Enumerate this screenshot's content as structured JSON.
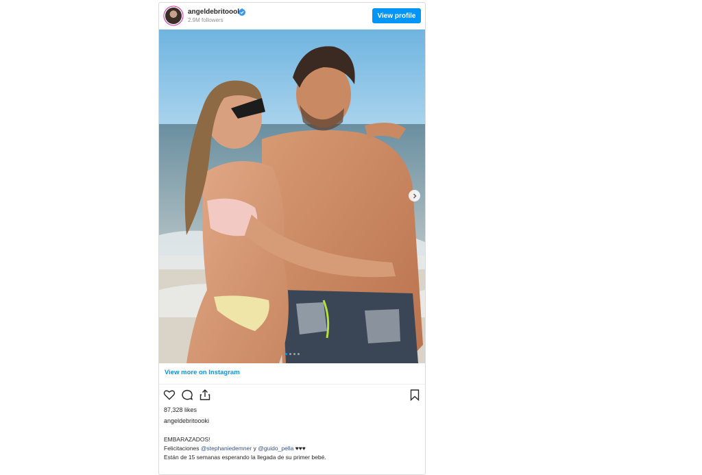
{
  "post": {
    "username": "angeldebritoooki",
    "followers": "2.9M followers",
    "view_profile_label": "View profile",
    "view_more_label": "View more on Instagram",
    "likes": "87,328 likes",
    "caption_username": "angeldebritoooki",
    "caption": {
      "line1": "EMBARAZADOS!",
      "line2_prefix": "Felicitaciones",
      "mention1": "@stephaniedemner",
      "line2_mid": "y",
      "mention2": "@guido_pella",
      "line2_suffix": "♥♥♥",
      "line3": "Están de 15 semanas esperando la llegada de su primer bebé."
    }
  },
  "icons": {
    "verified": "verified-badge-icon",
    "like": "heart-icon",
    "comment": "comment-icon",
    "share": "share-icon",
    "save": "bookmark-icon",
    "next": "chevron-right-icon"
  },
  "colors": {
    "accent": "#0095f6",
    "text": "#262626",
    "muted": "#8e8e8e",
    "border": "#dbdbdb"
  }
}
